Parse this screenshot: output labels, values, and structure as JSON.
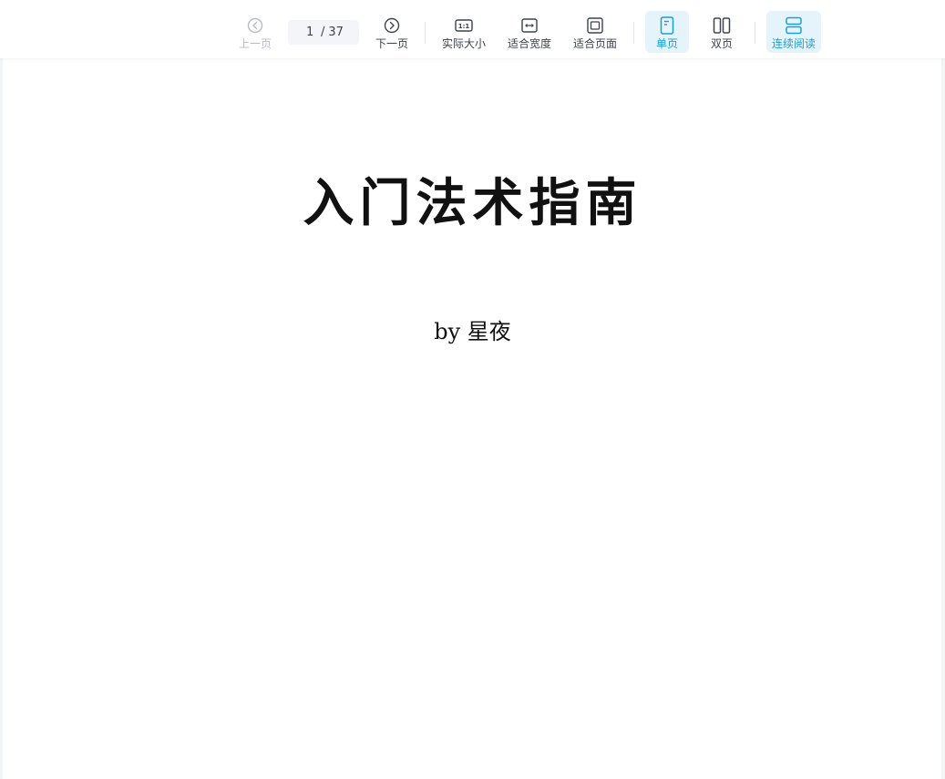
{
  "toolbar": {
    "prev_label": "上一页",
    "current_page": "1",
    "page_sep": "/",
    "total_pages": "37",
    "next_label": "下一页",
    "actual_size_label": "实际大小",
    "actual_size_icon_text": "1:1",
    "fit_width_label": "适合宽度",
    "fit_page_label": "适合页面",
    "single_page_label": "单页",
    "double_page_label": "双页",
    "continuous_label": "连续阅读",
    "active_modes": [
      "单页",
      "连续阅读"
    ],
    "accent_color": "#1a9fd6",
    "disabled_color": "#b7bcc4",
    "icons": {
      "prev": "chevron-left-circle-icon",
      "next": "chevron-right-circle-icon",
      "actual_size": "one-to-one-icon",
      "fit_width": "fit-width-icon",
      "fit_page": "fit-page-icon",
      "single_page": "single-page-icon",
      "double_page": "double-page-icon",
      "continuous": "continuous-scroll-icon"
    }
  },
  "document": {
    "title": "入门法术指南",
    "author": "by 星夜"
  }
}
